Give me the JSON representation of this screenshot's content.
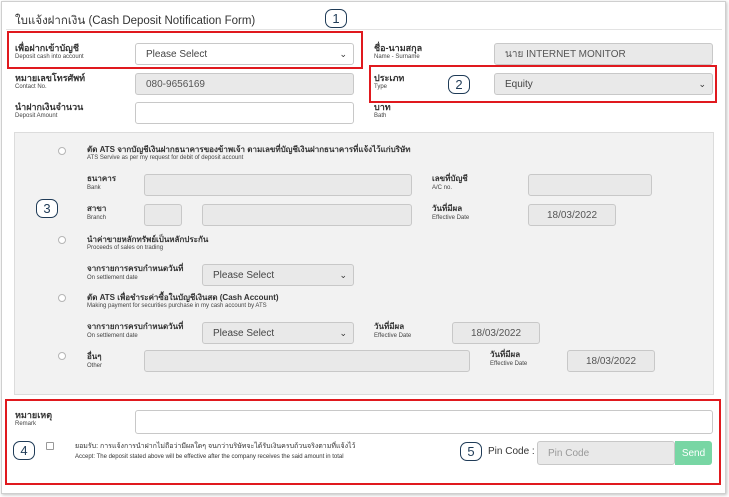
{
  "form": {
    "title": "ใบแจ้งฝากเงิน (Cash Deposit Notification Form)"
  },
  "fields": {
    "deposit_into_th": "เพื่อฝากเข้าบัญชี",
    "deposit_into_en": "Deposit cash into account",
    "deposit_into_value": "Please Select",
    "name_th": "ชื่อ-นามสกุล",
    "name_en": "Name - Surname",
    "name_value": "นาย INTERNET MONITOR",
    "contact_th": "หมายเลขโทรศัพท์",
    "contact_en": "Contact No.",
    "contact_value": "080-9656169",
    "type_th": "ประเภท",
    "type_en": "Type",
    "type_value": "Equity",
    "amount_th": "นำฝากเงินจำนวน",
    "amount_en": "Deposit Amount",
    "amount_value": "",
    "baht_th": "บาท",
    "baht_en": "Bath"
  },
  "options": {
    "ats_debit_th": "ตัด ATS จากบัญชีเงินฝากธนาคารของข้าพเจ้า ตามเลขที่บัญชีเงินฝากธนาคารที่แจ้งไว้แก่บริษัท",
    "ats_debit_en": "ATS Servive as per my request for debit of deposit account",
    "bank_th": "ธนาคาร",
    "bank_en": "Bank",
    "acno_th": "เลขที่บัญชี",
    "acno_en": "A/C no.",
    "branch_th": "สาขา",
    "branch_en": "Branch",
    "effective_th": "วันที่มีผล",
    "effective_en": "Effective Date",
    "date1": "18/03/2022",
    "proceeds_th": "นำค่าขายหลักทรัพย์เป็นหลักประกัน",
    "proceeds_en": "Proceeds of sales on trading",
    "settlement_th": "จากรายการครบกำหนดวันที่",
    "settlement_en": "On settlement date",
    "settlement_select": "Please Select",
    "ats_cash_th": "ตัด ATS เพื่อชำระค่าซื้อในบัญชีเงินสด (Cash Account)",
    "ats_cash_en": "Making payment for securities purchase in my cash account by ATS",
    "settlement2_select": "Please Select",
    "date2": "18/03/2022",
    "other_th": "อื่นๆ",
    "other_en": "Other",
    "date3": "18/03/2022"
  },
  "footer": {
    "remark_th": "หมายเหตุ",
    "remark_en": "Remark",
    "accept_th": "ยอมรับ: การแจ้งการนำฝากไม่ถือว่ามีผลใดๆ จนกว่าบริษัทจะได้รับเงินครบถ้วนจริงตามที่แจ้งไว้",
    "accept_en": "Accept: The deposit stated above will be effective after the company receives the said amount in total",
    "pin_label": "Pin Code :",
    "pin_placeholder": "Pin Code",
    "send_label": "Send"
  },
  "annotations": [
    "1",
    "2",
    "3",
    "4",
    "5"
  ],
  "colors": {
    "annotation_red": "#e0191e",
    "badge_navy": "#1f3b57",
    "send_green": "#78d6a4"
  }
}
